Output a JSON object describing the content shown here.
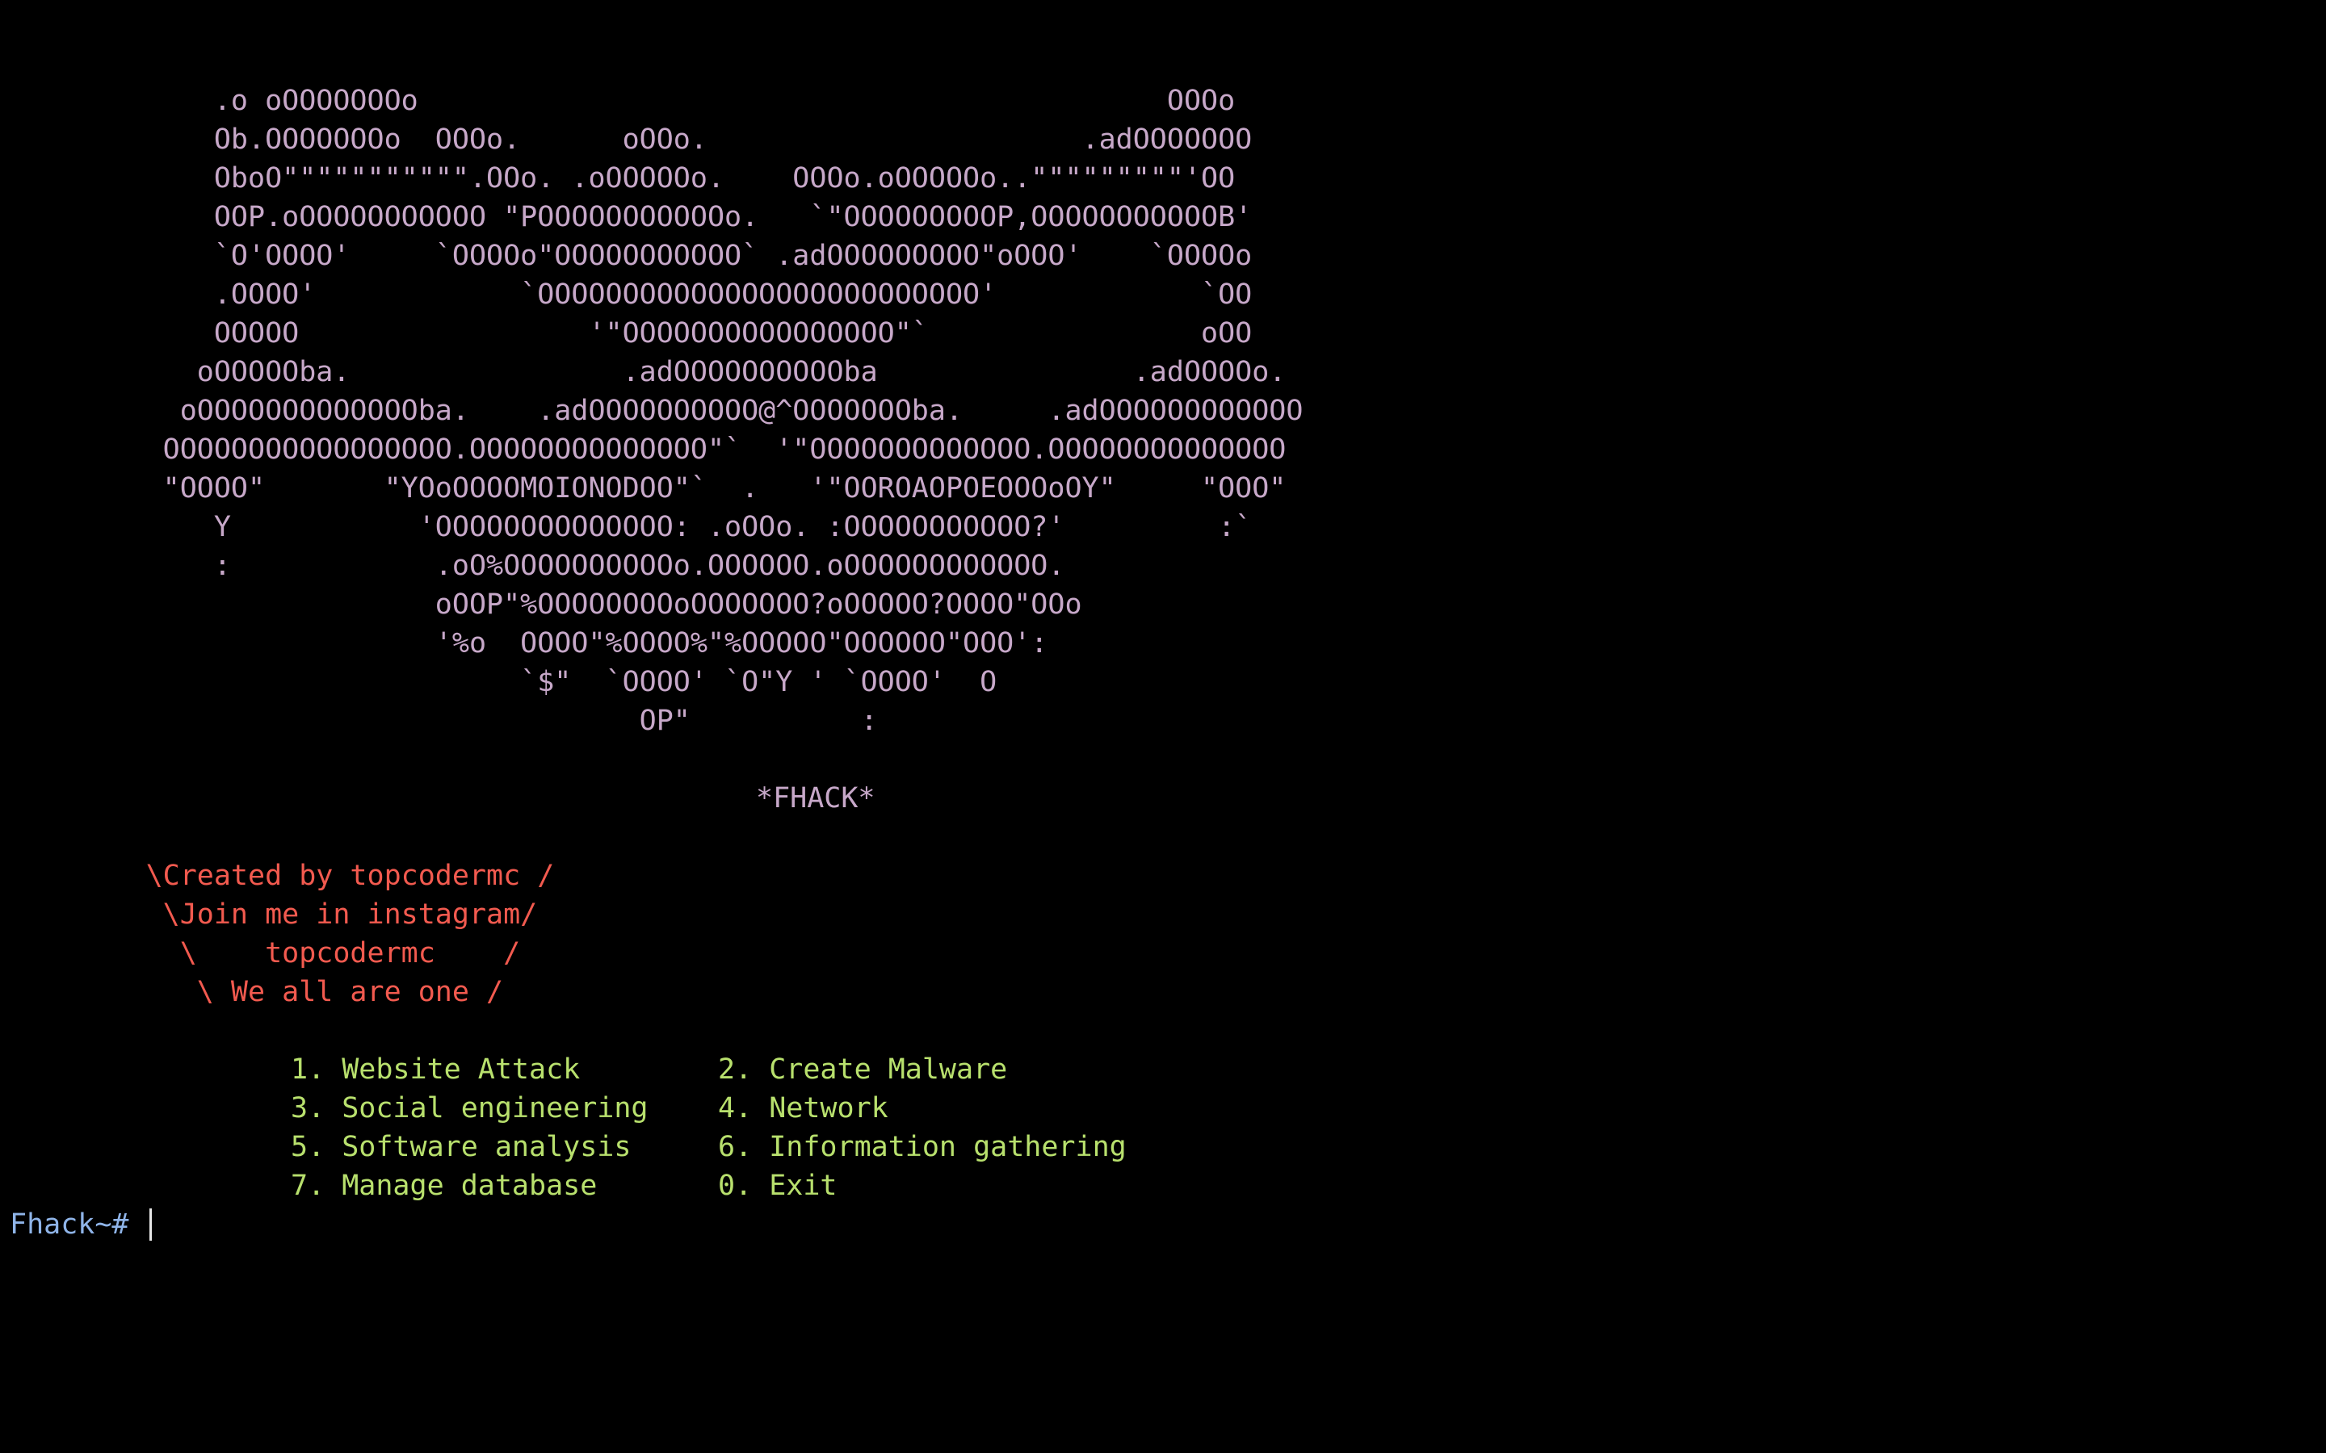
{
  "terminal": {
    "colors": {
      "background": "#000000",
      "art": "#c7a8c9",
      "credits": "#f25a4f",
      "menu": "#b8e06d",
      "prompt": "#8fb4e8"
    },
    "art_lines": [
      "            .o oOOOOOOOo                                            OOOo",
      "            Ob.OOOOOOOo  OOOo.      oOOo.                      .adOOOOOOO",
      "            OboO\"\"\"\"\"\"\"\"\"\"\".OOo. .oOOOOOo.    OOOo.oOOOOOo..\"\"\"\"\"\"\"\"\"'OO",
      "            OOP.oOOOOOOOOOOO \"POOOOOOOOOOOo.   `\"OOOOOOOOOP,OOOOOOOOOOOB'",
      "            `O'OOOO'     `OOOOo\"OOOOOOOOOOO` .adOOOOOOOOO\"oOOO'    `OOOOo",
      "            .OOOO'            `OOOOOOOOOOOOOOOOOOOOOOOOOO'            `OO",
      "            OOOOO                 '\"OOOOOOOOOOOOOOOO\"`                oOO",
      "           oOOOOOba.                .adOOOOOOOOOOba               .adOOOOo.",
      "          oOOOOOOOOOOOOOba.    .adOOOOOOOOOO@^OOOOOOOba.     .adOOOOOOOOOOOO",
      "         OOOOOOOOOOOOOOOOO.OOOOOOOOOOOOOO\"`  '\"OOOOOOOOOOOOO.OOOOOOOOOOOOOO",
      "         \"OOOO\"       \"YOoOOOOMOIONODOO\"`  .   '\"OOROAOPOEOOOoOY\"     \"OOO\"",
      "            Y           'OOOOOOOOOOOOOO: .oOOo. :OOOOOOOOOOO?'         :`",
      "            :            .oO%OOOOOOOOOOo.OOOOOO.oOOOOOOOOOOOO.",
      "                         oOOP\"%OOOOOOOOoOOOOOOO?oOOOOO?OOOO\"OOo",
      "                         '%o  OOOO\"%OOOO%\"%OOOOO\"OOOOOO\"OOO':",
      "                              `$\"  `OOOO' `O\"Y ' `OOOO'  O",
      "                                     OP\"          :"
    ],
    "banner_title": "*FHACK*",
    "credits": [
      "        \\Created by topcodermc /",
      "         \\Join me in instagram/",
      "          \\    topcodermc    /",
      "           \\ We all are one /"
    ],
    "menu": [
      {
        "left": "1. Website Attack",
        "right": "2. Create Malware"
      },
      {
        "left": "3. Social engineering",
        "right": "4. Network"
      },
      {
        "left": "5. Software analysis",
        "right": "6. Information gathering"
      },
      {
        "left": "7. Manage database",
        "right": "0. Exit"
      }
    ],
    "prompt": "Fhack~# "
  }
}
